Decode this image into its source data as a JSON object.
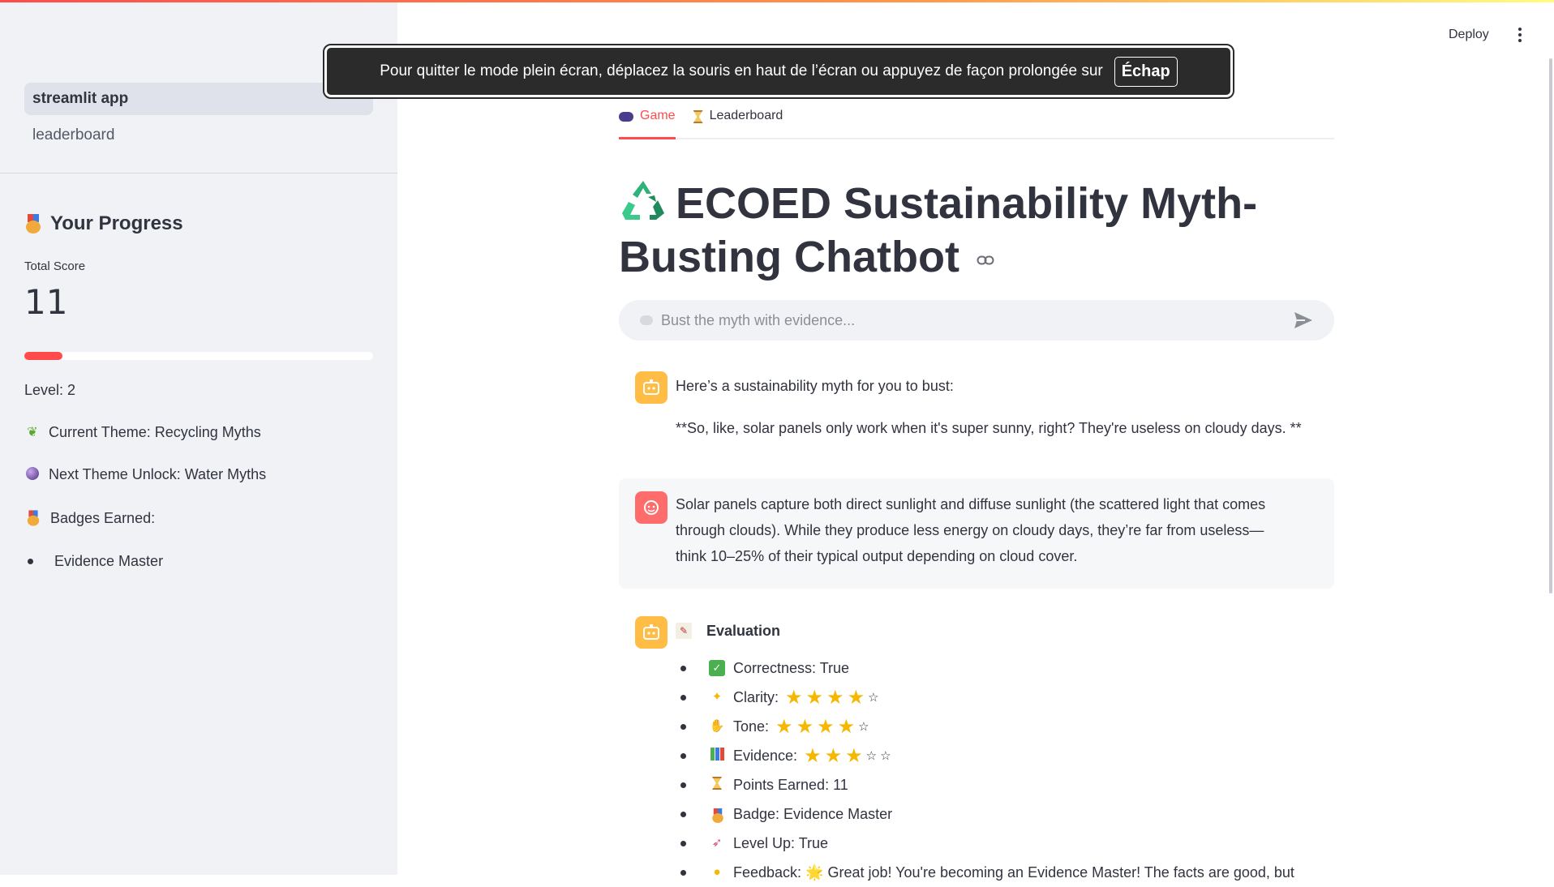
{
  "header": {
    "deploy_label": "Deploy"
  },
  "toast": {
    "text": "Pour quitter le mode plein écran, déplacez la souris en haut de l’écran ou appuyez de façon prolongée sur",
    "key": "Échap"
  },
  "sidebar": {
    "nav": [
      {
        "label": "streamlit app",
        "active": true
      },
      {
        "label": "leaderboard",
        "active": false
      }
    ],
    "progress_title": "Your Progress",
    "total_score_label": "Total Score",
    "total_score_value": "11",
    "progress_fraction": 0.11,
    "level_text": "Level: 2",
    "current_theme_text": "Current Theme: Recycling Myths",
    "next_theme_text": "Next Theme Unlock: Water Myths",
    "badges_label": "Badges Earned:",
    "badges": [
      "Evidence Master"
    ]
  },
  "tabs": [
    {
      "label": "Game",
      "icon": "gamepad-icon",
      "active": true
    },
    {
      "label": "Leaderboard",
      "icon": "hourglass-icon",
      "active": false
    }
  ],
  "title": {
    "line1": "ECOED Sustainability Myth-",
    "line2": "Busting Chatbot"
  },
  "chat_input": {
    "placeholder": "Bust the myth with evidence..."
  },
  "messages": {
    "bot_intro": "Here’s a sustainability myth for you to bust:",
    "bot_myth": "**So, like, solar panels only work when it's super sunny, right? They're useless on cloudy days. **",
    "user_line1": "Solar panels capture both direct sunlight and diffuse sunlight (the scattered light that comes",
    "user_line2": "through clouds). While they produce less energy on cloudy days, they’re far from useless—",
    "user_line3": "think 10–25% of their typical output depending on cloud cover."
  },
  "evaluation": {
    "heading": "Evaluation",
    "correctness": "Correctness: True",
    "clarity_label": "Clarity:",
    "clarity_stars": 4,
    "tone_label": "Tone:",
    "tone_stars": 4,
    "evidence_label": "Evidence:",
    "evidence_stars": 3,
    "points": "Points Earned: 11",
    "badge": "Badge: Evidence Master",
    "level_up": "Level Up: True",
    "feedback": "Feedback: 🌟 Great job! You're becoming an Evidence Master! The facts are good, but"
  },
  "colors": {
    "accent": "#ff4b4b",
    "sidebar_bg": "#f0f2f6",
    "bot_avatar": "#ffbd45",
    "user_avatar": "#ff6c6c"
  }
}
